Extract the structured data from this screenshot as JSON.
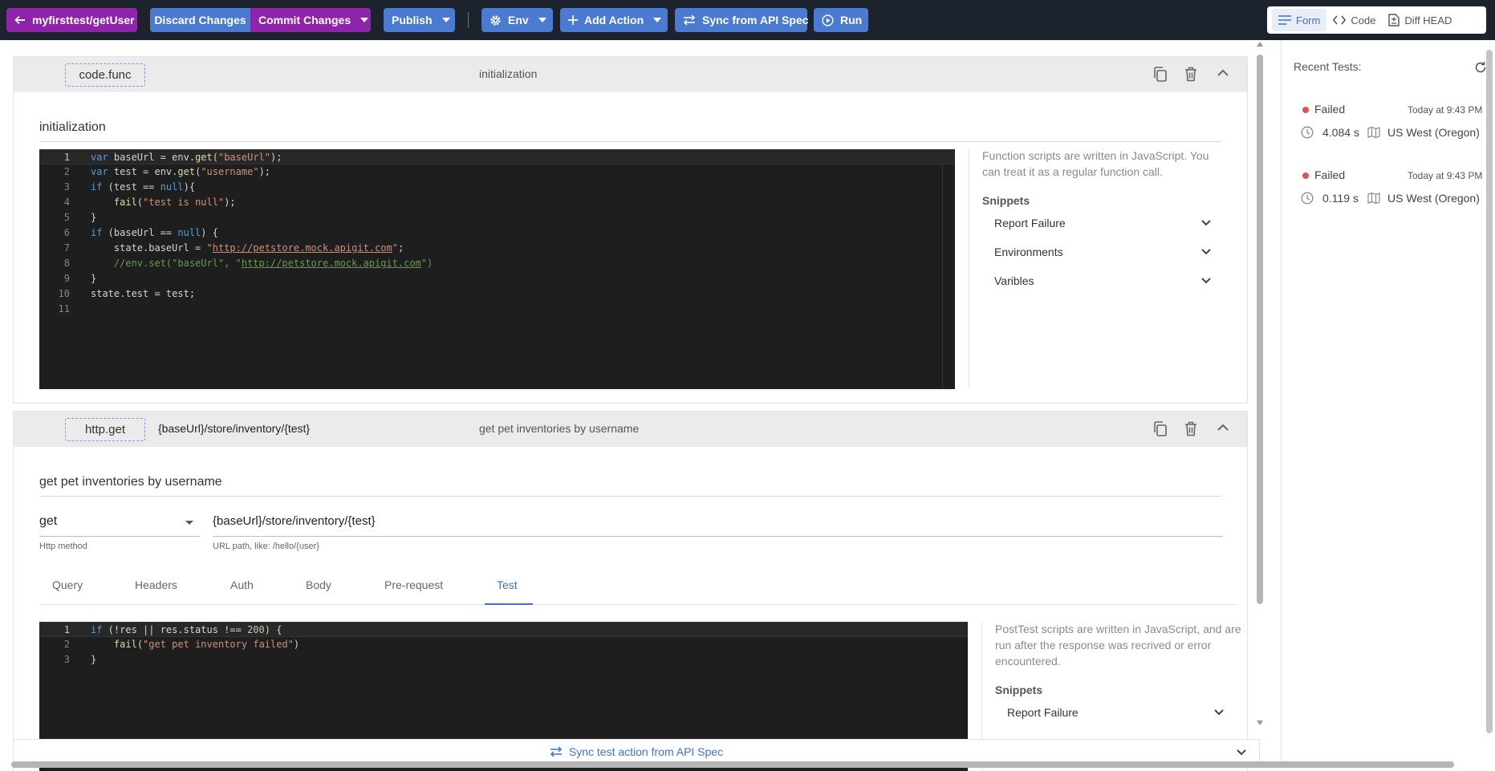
{
  "toolbar": {
    "back_label": "myfirsttest/getUser",
    "discard_label": "Discard Changes",
    "commit_label": "Commit Changes",
    "publish_label": "Publish",
    "env_label": "Env",
    "add_action_label": "Add Action",
    "sync_label": "Sync from API Spec",
    "run_label": "Run",
    "views": [
      {
        "label": "Form",
        "icon": "form-lines-icon",
        "active": true
      },
      {
        "label": "Code",
        "icon": "code-brackets-icon",
        "active": false
      },
      {
        "label": "Diff HEAD",
        "icon": "diff-file-icon",
        "active": false
      }
    ]
  },
  "action1": {
    "type": "code.func",
    "header_title": "initialization",
    "section_title": "initialization",
    "code_lines": [
      "var baseUrl = env.get(\"baseUrl\");",
      "var test = env.get(\"username\");",
      "if (test == null){",
      "    fail(\"test is null\");",
      "}",
      "if (baseUrl == null) {",
      "    state.baseUrl = \"http://petstore.mock.apigit.com\";",
      "    //env.set(\"baseUrl\", \"http://petstore.mock.apigit.com\")",
      "}",
      "state.test = test;",
      ""
    ],
    "help_text": "Function scripts are written in JavaScript. You can treat it as a regular function call.",
    "snippets_heading": "Snippets",
    "snippets": [
      "Report Failure",
      "Environments",
      "Varibles"
    ]
  },
  "action2": {
    "type": "http.get",
    "header_path": "{baseUrl}/store/inventory/{test}",
    "header_title": "get pet inventories by username",
    "section_title": "get pet inventories by username",
    "method": {
      "value": "get",
      "label": "Http method"
    },
    "url": {
      "value": "{baseUrl}/store/inventory/{test}",
      "label": "URL path, like: /hello/{user}"
    },
    "tabs": [
      "Query",
      "Headers",
      "Auth",
      "Body",
      "Pre-request",
      "Test"
    ],
    "active_tab": "Test",
    "code_lines": [
      "if (!res || res.status !== 200) {",
      "    fail(\"get pet inventory failed\")",
      "}"
    ],
    "help_text": "PostTest scripts are written in JavaScript, and are run after the response was recrived or error encountered.",
    "snippets_heading": "Snippets",
    "snippets": [
      "Report Failure"
    ]
  },
  "sync_bar_label": "Sync test action from API Spec",
  "recent": {
    "title": "Recent Tests:",
    "items": [
      {
        "status": "Failed",
        "time": "Today at 9:43 PM",
        "duration": "4.084 s",
        "region": "US West (Oregon)"
      },
      {
        "status": "Failed",
        "time": "Today at 9:43 PM",
        "duration": "0.119 s",
        "region": "US West (Oregon)"
      }
    ]
  },
  "colors": {
    "topbar": "#1d232c",
    "purple": "#8e24aa",
    "blue": "#4b7bd0",
    "accent": "#3f6fd0",
    "failed": "#e05252",
    "editor_bg": "#1e1e1e"
  }
}
